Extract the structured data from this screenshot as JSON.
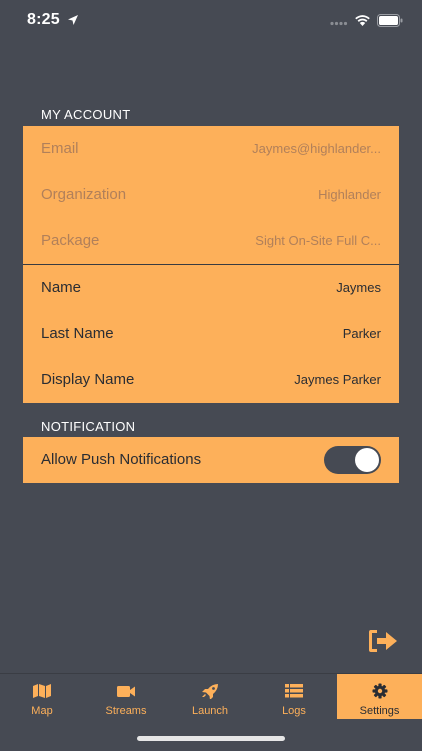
{
  "status_bar": {
    "time": "8:25"
  },
  "colors": {
    "background": "#464a53",
    "accent": "#fdb05a",
    "dark_text": "#2a2d33",
    "muted_text": "#b1805a"
  },
  "account": {
    "header": "MY ACCOUNT",
    "readonly_rows": [
      {
        "label": "Email",
        "value": "Jaymes@highlander..."
      },
      {
        "label": "Organization",
        "value": "Highlander"
      },
      {
        "label": "Package",
        "value": "Sight On-Site Full C..."
      }
    ],
    "editable_rows": [
      {
        "label": "Name",
        "value": "Jaymes"
      },
      {
        "label": "Last Name",
        "value": "Parker"
      },
      {
        "label": "Display Name",
        "value": "Jaymes Parker"
      }
    ]
  },
  "notification": {
    "header": "NOTIFICATION",
    "push_label": "Allow Push Notifications",
    "push_enabled": true
  },
  "tabs": [
    {
      "label": "Map",
      "icon": "map-icon",
      "active": false
    },
    {
      "label": "Streams",
      "icon": "video-camera-icon",
      "active": false
    },
    {
      "label": "Launch",
      "icon": "rocket-icon",
      "active": false
    },
    {
      "label": "Logs",
      "icon": "list-icon",
      "active": false
    },
    {
      "label": "Settings",
      "icon": "gear-icon",
      "active": true
    }
  ],
  "logout_icon": "logout-icon"
}
